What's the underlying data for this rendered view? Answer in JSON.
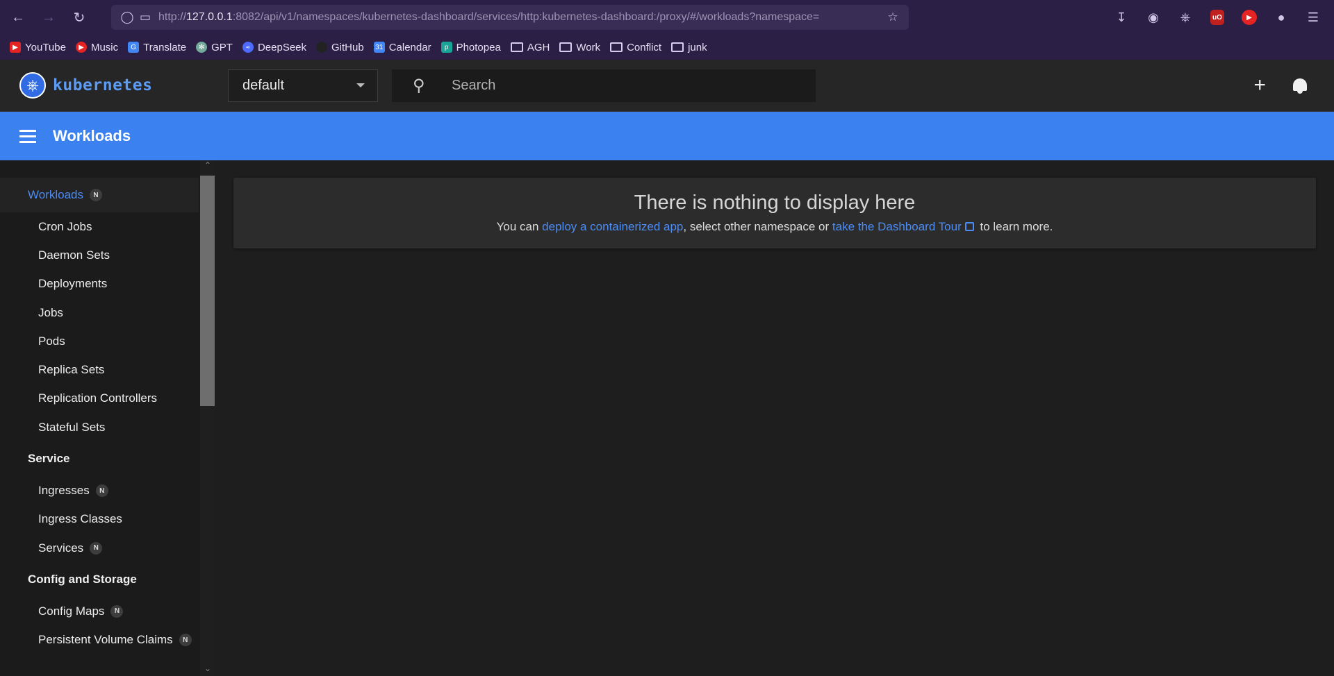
{
  "browser": {
    "url_prefix": "http://",
    "url_host": "127.0.0.1",
    "url_rest": ":8082/api/v1/namespaces/kubernetes-dashboard/services/http:kubernetes-dashboard:/proxy/#/workloads?namespace=",
    "bookmarks": [
      {
        "label": "YouTube",
        "icon": "youtube-icon",
        "color": "#e52323"
      },
      {
        "label": "Music",
        "icon": "music-icon",
        "color": "#e52323"
      },
      {
        "label": "Translate",
        "icon": "translate-icon",
        "color": "#4285f4"
      },
      {
        "label": "GPT",
        "icon": "openai-icon",
        "color": "#74aa9c"
      },
      {
        "label": "DeepSeek",
        "icon": "deepseek-icon",
        "color": "#4d6bfe"
      },
      {
        "label": "GitHub",
        "icon": "github-icon",
        "color": "#222222"
      },
      {
        "label": "Calendar",
        "icon": "calendar-icon",
        "color": "#4285f4"
      },
      {
        "label": "Photopea",
        "icon": "photopea-icon",
        "color": "#18a497"
      },
      {
        "label": "AGH",
        "icon": "folder-icon"
      },
      {
        "label": "Work",
        "icon": "folder-icon"
      },
      {
        "label": "Conflict",
        "icon": "folder-icon"
      },
      {
        "label": "junk",
        "icon": "folder-icon"
      }
    ]
  },
  "header": {
    "brand": "kubernetes",
    "namespace": "default",
    "search_placeholder": "Search"
  },
  "titlebar": {
    "title": "Workloads"
  },
  "sidebar": {
    "workloads_label": "Workloads",
    "workloads_badge": "N",
    "workloads_items": [
      "Cron Jobs",
      "Daemon Sets",
      "Deployments",
      "Jobs",
      "Pods",
      "Replica Sets",
      "Replication Controllers",
      "Stateful Sets"
    ],
    "service_label": "Service",
    "service_items": [
      {
        "label": "Ingresses",
        "badge": "N"
      },
      {
        "label": "Ingress Classes",
        "badge": ""
      },
      {
        "label": "Services",
        "badge": "N"
      }
    ],
    "config_label": "Config and Storage",
    "config_items": [
      {
        "label": "Config Maps",
        "badge": "N"
      },
      {
        "label": "Persistent Volume Claims",
        "badge": "N"
      }
    ]
  },
  "main": {
    "empty_title": "There is nothing to display here",
    "desc_prefix": "You can ",
    "desc_link1": "deploy a containerized app",
    "desc_middle": ", select other namespace or ",
    "desc_link2": "take the Dashboard Tour",
    "desc_suffix": " to learn more."
  },
  "colors": {
    "accent": "#3b82f0",
    "link": "#4b8cf5",
    "browser_frame": "#2b1f45"
  }
}
